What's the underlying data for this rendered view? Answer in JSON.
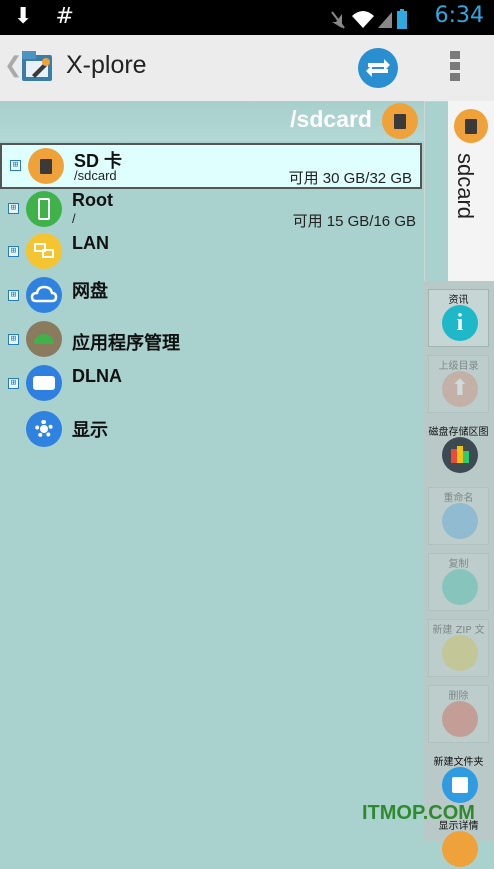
{
  "status_bar": {
    "left_icons": [
      "download-icon",
      "hash-icon"
    ],
    "left_glyphs": [
      "⬇",
      "#"
    ],
    "time": "6:34"
  },
  "action_bar": {
    "back_glyph": "❮",
    "title": "X-plore"
  },
  "path_bar": {
    "path": "/sdcard"
  },
  "tree": [
    {
      "name": "SD 卡",
      "sub": "/sdcard",
      "space": "可用 30 GB/32 GB",
      "icon": "sd-card-icon",
      "color": "#f0a23a",
      "selected": true,
      "expander": "⊞"
    },
    {
      "name": "Root",
      "sub": "/",
      "space": "可用 15 GB/16 GB",
      "icon": "phone-icon",
      "color": "#3fb24a",
      "expander": "⊞"
    },
    {
      "name": "LAN",
      "icon": "lan-icon",
      "color": "#f5c431",
      "expander": "⊞"
    },
    {
      "name": "网盘",
      "icon": "cloud-icon",
      "color": "#2f82e0",
      "expander": "⊞"
    },
    {
      "name": "应用程序管理",
      "icon": "android-icon",
      "color": "#8b7b5e",
      "expander": "⊞"
    },
    {
      "name": "DLNA",
      "icon": "dlna-icon",
      "color": "#2f7fe0",
      "expander": "⊞"
    },
    {
      "name": "显示",
      "icon": "gear-icon",
      "color": "#2f82e0"
    }
  ],
  "side_panel": {
    "label": "sdcard"
  },
  "operations": [
    {
      "label": "资讯",
      "icon": "info-icon",
      "color": "#1fb8c8",
      "enabled": true
    },
    {
      "label": "上级目录",
      "icon": "up-arrow-icon",
      "color": "#d9866b",
      "enabled": false
    },
    {
      "label": "磁盘存储区图",
      "icon": "disk-map-icon",
      "color": "#3d4a52",
      "enabled": true
    },
    {
      "label": "重命名",
      "icon": "rename-icon",
      "color": "#4aa3e0",
      "enabled": false
    },
    {
      "label": "复制",
      "icon": "copy-icon",
      "color": "#2fbfa8",
      "enabled": false
    },
    {
      "label": "新建 ZIP 文件",
      "icon": "zip-icon",
      "color": "#d8c23a",
      "enabled": false
    },
    {
      "label": "删除",
      "icon": "trash-icon",
      "color": "#d9503a",
      "enabled": false
    },
    {
      "label": "新建文件夹",
      "icon": "new-folder-icon",
      "color": "#2f9be0",
      "enabled": true
    },
    {
      "label": "显示详情",
      "icon": "details-icon",
      "color": "#f0a23a",
      "enabled": true
    }
  ],
  "watermark": "ITMOP.COM"
}
